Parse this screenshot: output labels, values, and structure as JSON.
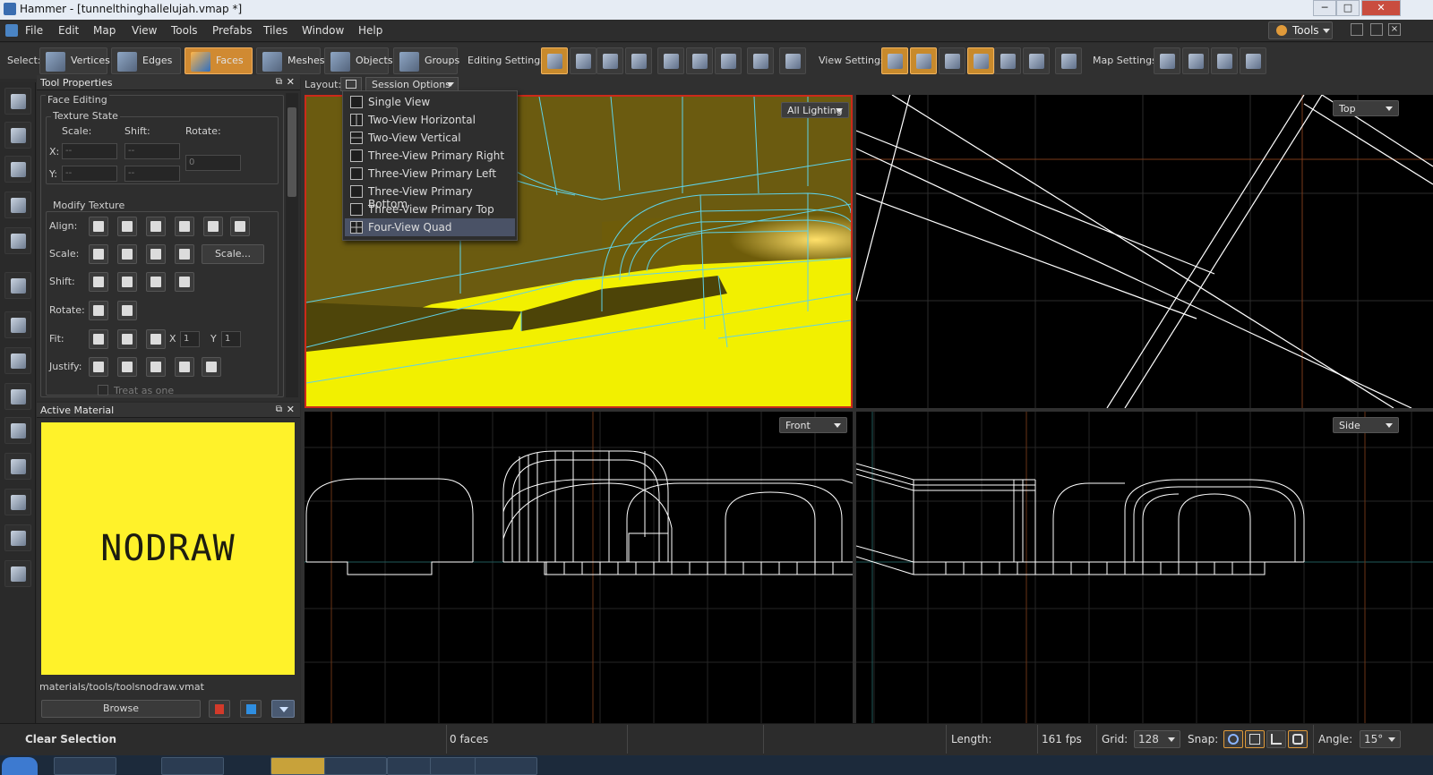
{
  "window": {
    "title": "Hammer - [tunnelthinghallelujah.vmap *]",
    "min": "─",
    "max": "□",
    "close": "✕"
  },
  "menu": [
    "File",
    "Edit",
    "Map",
    "View",
    "Tools",
    "Prefabs",
    "Tiles",
    "Window",
    "Help"
  ],
  "tools_dropdown": "Tools",
  "toolbar": {
    "select_label": "Select:",
    "select_modes": [
      {
        "label": "Vertices",
        "icon": "vertices-icon"
      },
      {
        "label": "Edges",
        "icon": "edges-icon"
      },
      {
        "label": "Faces",
        "icon": "faces-icon"
      },
      {
        "label": "Meshes",
        "icon": "meshes-icon"
      },
      {
        "label": "Objects",
        "icon": "objects-icon"
      },
      {
        "label": "Groups",
        "icon": "groups-icon"
      }
    ],
    "editing_settings_label": "Editing Settings:",
    "view_settings_label": "View Settings:",
    "map_settings_label": "Map Settings:"
  },
  "tool_properties": {
    "title": "Tool Properties",
    "face_editing": "Face Editing",
    "texture_state": {
      "title": "Texture State",
      "scale_label": "Scale:",
      "shift_label": "Shift:",
      "rotate_label": "Rotate:",
      "x_label": "X:",
      "y_label": "Y:",
      "placeholder": "--",
      "rotate_value": "0"
    },
    "modify_texture": {
      "title": "Modify Texture",
      "rows": [
        "Align:",
        "Scale:",
        "Shift:",
        "Rotate:",
        "Fit:",
        "Justify:"
      ],
      "scale_button": "Scale...",
      "fit_x_label": "X",
      "fit_y_label": "Y",
      "fit_x": "1",
      "fit_y": "1",
      "treat_as_one": "Treat as one"
    }
  },
  "active_material": {
    "title": "Active Material",
    "preview_text": "NODRAW",
    "path": "materials/tools/toolsnodraw.vmat",
    "browse": "Browse",
    "preview_color": "#fff22a"
  },
  "layout": {
    "label": "Layout:",
    "session_options": "Session Options",
    "menu": [
      {
        "label": "Single View",
        "selected": false
      },
      {
        "label": "Two-View Horizontal",
        "selected": false
      },
      {
        "label": "Two-View Vertical",
        "selected": false
      },
      {
        "label": "Three-View Primary Right",
        "selected": false
      },
      {
        "label": "Three-View Primary Left",
        "selected": false
      },
      {
        "label": "Three-View Primary Bottom",
        "selected": false
      },
      {
        "label": "Three-View Primary Top",
        "selected": false
      },
      {
        "label": "Four-View Quad",
        "selected": true
      }
    ]
  },
  "viewports": {
    "perspective": "All Lighting",
    "top": "Top",
    "front": "Front",
    "side": "Side"
  },
  "status": {
    "clear_selection": "Clear Selection",
    "faces": "0 faces",
    "length_label": "Length:",
    "fps": "161 fps",
    "grid_label": "Grid:",
    "grid_value": "128",
    "snap_label": "Snap:",
    "angle_label": "Angle:",
    "angle_value": "15°"
  },
  "colors": {
    "accent": "#d08a32",
    "selection_border": "#cc2a1a",
    "wire": "#5fd2e8",
    "yellow": "#f2f000"
  }
}
